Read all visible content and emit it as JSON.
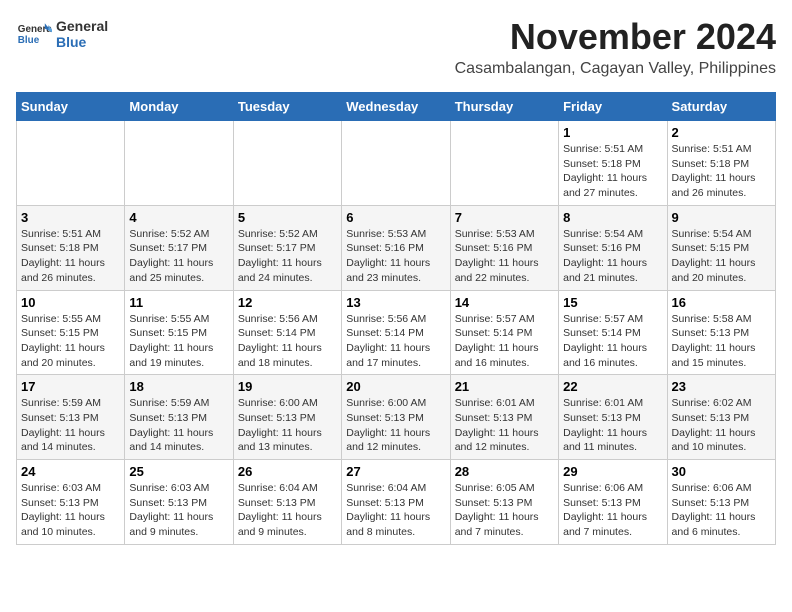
{
  "logo": {
    "general": "General",
    "blue": "Blue"
  },
  "title": "November 2024",
  "subtitle": "Casambalangan, Cagayan Valley, Philippines",
  "weekdays": [
    "Sunday",
    "Monday",
    "Tuesday",
    "Wednesday",
    "Thursday",
    "Friday",
    "Saturday"
  ],
  "weeks": [
    [
      {
        "day": "",
        "info": ""
      },
      {
        "day": "",
        "info": ""
      },
      {
        "day": "",
        "info": ""
      },
      {
        "day": "",
        "info": ""
      },
      {
        "day": "",
        "info": ""
      },
      {
        "day": "1",
        "info": "Sunrise: 5:51 AM\nSunset: 5:18 PM\nDaylight: 11 hours and 27 minutes."
      },
      {
        "day": "2",
        "info": "Sunrise: 5:51 AM\nSunset: 5:18 PM\nDaylight: 11 hours and 26 minutes."
      }
    ],
    [
      {
        "day": "3",
        "info": "Sunrise: 5:51 AM\nSunset: 5:18 PM\nDaylight: 11 hours and 26 minutes."
      },
      {
        "day": "4",
        "info": "Sunrise: 5:52 AM\nSunset: 5:17 PM\nDaylight: 11 hours and 25 minutes."
      },
      {
        "day": "5",
        "info": "Sunrise: 5:52 AM\nSunset: 5:17 PM\nDaylight: 11 hours and 24 minutes."
      },
      {
        "day": "6",
        "info": "Sunrise: 5:53 AM\nSunset: 5:16 PM\nDaylight: 11 hours and 23 minutes."
      },
      {
        "day": "7",
        "info": "Sunrise: 5:53 AM\nSunset: 5:16 PM\nDaylight: 11 hours and 22 minutes."
      },
      {
        "day": "8",
        "info": "Sunrise: 5:54 AM\nSunset: 5:16 PM\nDaylight: 11 hours and 21 minutes."
      },
      {
        "day": "9",
        "info": "Sunrise: 5:54 AM\nSunset: 5:15 PM\nDaylight: 11 hours and 20 minutes."
      }
    ],
    [
      {
        "day": "10",
        "info": "Sunrise: 5:55 AM\nSunset: 5:15 PM\nDaylight: 11 hours and 20 minutes."
      },
      {
        "day": "11",
        "info": "Sunrise: 5:55 AM\nSunset: 5:15 PM\nDaylight: 11 hours and 19 minutes."
      },
      {
        "day": "12",
        "info": "Sunrise: 5:56 AM\nSunset: 5:14 PM\nDaylight: 11 hours and 18 minutes."
      },
      {
        "day": "13",
        "info": "Sunrise: 5:56 AM\nSunset: 5:14 PM\nDaylight: 11 hours and 17 minutes."
      },
      {
        "day": "14",
        "info": "Sunrise: 5:57 AM\nSunset: 5:14 PM\nDaylight: 11 hours and 16 minutes."
      },
      {
        "day": "15",
        "info": "Sunrise: 5:57 AM\nSunset: 5:14 PM\nDaylight: 11 hours and 16 minutes."
      },
      {
        "day": "16",
        "info": "Sunrise: 5:58 AM\nSunset: 5:13 PM\nDaylight: 11 hours and 15 minutes."
      }
    ],
    [
      {
        "day": "17",
        "info": "Sunrise: 5:59 AM\nSunset: 5:13 PM\nDaylight: 11 hours and 14 minutes."
      },
      {
        "day": "18",
        "info": "Sunrise: 5:59 AM\nSunset: 5:13 PM\nDaylight: 11 hours and 14 minutes."
      },
      {
        "day": "19",
        "info": "Sunrise: 6:00 AM\nSunset: 5:13 PM\nDaylight: 11 hours and 13 minutes."
      },
      {
        "day": "20",
        "info": "Sunrise: 6:00 AM\nSunset: 5:13 PM\nDaylight: 11 hours and 12 minutes."
      },
      {
        "day": "21",
        "info": "Sunrise: 6:01 AM\nSunset: 5:13 PM\nDaylight: 11 hours and 12 minutes."
      },
      {
        "day": "22",
        "info": "Sunrise: 6:01 AM\nSunset: 5:13 PM\nDaylight: 11 hours and 11 minutes."
      },
      {
        "day": "23",
        "info": "Sunrise: 6:02 AM\nSunset: 5:13 PM\nDaylight: 11 hours and 10 minutes."
      }
    ],
    [
      {
        "day": "24",
        "info": "Sunrise: 6:03 AM\nSunset: 5:13 PM\nDaylight: 11 hours and 10 minutes."
      },
      {
        "day": "25",
        "info": "Sunrise: 6:03 AM\nSunset: 5:13 PM\nDaylight: 11 hours and 9 minutes."
      },
      {
        "day": "26",
        "info": "Sunrise: 6:04 AM\nSunset: 5:13 PM\nDaylight: 11 hours and 9 minutes."
      },
      {
        "day": "27",
        "info": "Sunrise: 6:04 AM\nSunset: 5:13 PM\nDaylight: 11 hours and 8 minutes."
      },
      {
        "day": "28",
        "info": "Sunrise: 6:05 AM\nSunset: 5:13 PM\nDaylight: 11 hours and 7 minutes."
      },
      {
        "day": "29",
        "info": "Sunrise: 6:06 AM\nSunset: 5:13 PM\nDaylight: 11 hours and 7 minutes."
      },
      {
        "day": "30",
        "info": "Sunrise: 6:06 AM\nSunset: 5:13 PM\nDaylight: 11 hours and 6 minutes."
      }
    ]
  ]
}
